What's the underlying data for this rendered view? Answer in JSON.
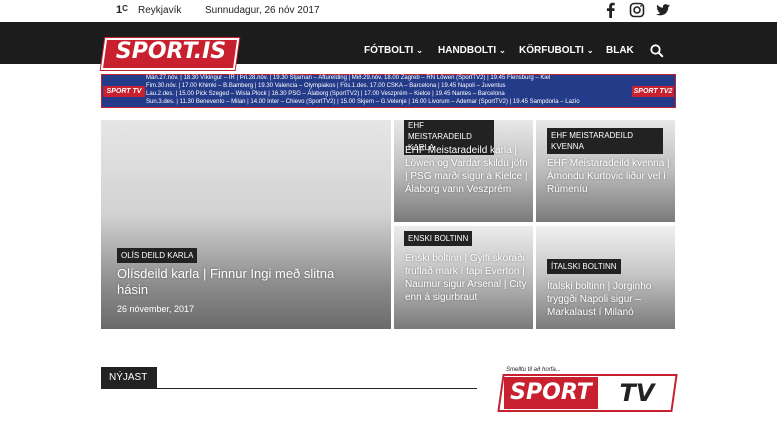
{
  "topbar": {
    "temp_value": "1",
    "temp_unit": "C",
    "city": "Reykjavík",
    "date": "Sunnudagur, 26 nóv 2017"
  },
  "social": [
    "facebook-icon",
    "instagram-icon",
    "twitter-icon"
  ],
  "brand": {
    "logo": "SPORT.IS",
    "accent": "#c8202f",
    "nav_bg": "#1c1c1c",
    "ticker_bg": "#243b8a"
  },
  "menu": [
    {
      "label": "FÓTBOLTI",
      "chevron": "⌄"
    },
    {
      "label": "HANDBOLTI",
      "chevron": "⌄"
    },
    {
      "label": "KÖRFUBOLTI",
      "chevron": "⌄"
    },
    {
      "label": "BLAK",
      "chevron": ""
    }
  ],
  "ticker": {
    "logo_left": "SPORT TV",
    "logo_right": "SPORT TV2",
    "rows": [
      "Mán.27.nóv. | 18.30 Víkingur – ÍR | Þri.28.nóv. | 19.30 Stjarnan – Afturelding | Mið.29.nóv. 18.00 Zagreb – RN Löwen (SportTV2) | 19.45 Flensburg – Kiel",
      "Fim.30.nóv. | 17.00 Khimki – B.Bamberg | 19.30 Valencia – Olympiakos | Fös.1.des. 17.00 CSKA – Barcelona | 19.45 Napoli – Juventus",
      "Lau.2.des. | 15.00 Pick Szeged – Wisla Plock | 16.30 PSG – Álaborg (SportTV2) | 17.00 Veszprém – Kielce | 19.45 Nantes – Barcelona",
      "Sun.3.des. | 11.30 Benevento – Milan | 14.00 Inter – Chievo (SportTV2) | 15.00 Skjern – G.Velenje | 16.00 Livorum – Ademar (SportTV2) | 19.45 Sampdoria – Lazio"
    ]
  },
  "featured": {
    "tag": "OLÍS DEILD KARLA",
    "title": "Olísdeild karla | Finnur Ingi með slitna hásin",
    "date": "26 nóvember, 2017"
  },
  "tiles": [
    {
      "tag": "EHF MEISTARADEILD KARLA",
      "title": "EHF Meistaradeild karla | Löwen og Vardar skildu jöfn | PSG marði sigur á Kielce | Álaborg vann Veszprém"
    },
    {
      "tag": "EHF MEISTARADEILD KVENNA",
      "title": "EHF Meistaradeild kvenna | Ámondu Kurtovic liður vel í Rúmeníu"
    },
    {
      "tag": "ENSKI BOLTINN",
      "title": "Enski boltinn | Gylfi skoraði truflað mark í tapi Everton | Naumur sigur Arsenal | City enn á sigurbraut"
    },
    {
      "tag": "ÍTALSKI BOLTINN",
      "title": "Ítalski boltinn | Jorginho tryggði Napoli sigur – Markalaust í Milanó"
    }
  ],
  "section": {
    "latest_tab": "NÝJAST"
  },
  "sporttv": {
    "caption": "Smelltu til að horfa...",
    "sport": "SPORT",
    "tv": "TV"
  }
}
